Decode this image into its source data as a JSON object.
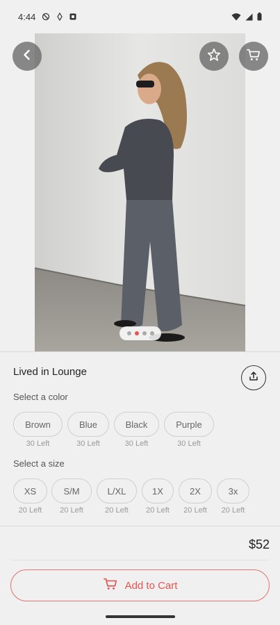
{
  "status_bar": {
    "time": "4:44",
    "icons": [
      "dnd-icon",
      "data-saver-icon",
      "notification-icon",
      "wifi-icon",
      "signal-icon",
      "battery-icon"
    ]
  },
  "header": {
    "back_icon": "chevron-left-icon",
    "favorite_icon": "star-outline-icon",
    "cart_icon": "cart-icon"
  },
  "gallery": {
    "image_count": 4,
    "active_index": 1,
    "image": "photo of woman in grey loungewear set"
  },
  "product": {
    "title": "Lived in Lounge",
    "share_icon": "share-icon",
    "price": "$52"
  },
  "colors": {
    "label": "Select a color",
    "options": [
      {
        "name": "Brown",
        "stock": "30 Left"
      },
      {
        "name": "Blue",
        "stock": "30 Left"
      },
      {
        "name": "Black",
        "stock": "30 Left"
      },
      {
        "name": "Purple",
        "stock": "30 Left"
      }
    ]
  },
  "sizes": {
    "label": "Select a size",
    "options": [
      {
        "name": "XS",
        "stock": "20 Left"
      },
      {
        "name": "S/M",
        "stock": "20 Left"
      },
      {
        "name": "L/XL",
        "stock": "20 Left"
      },
      {
        "name": "1X",
        "stock": "20 Left"
      },
      {
        "name": "2X",
        "stock": "20 Left"
      },
      {
        "name": "3x",
        "stock": "20 Left"
      }
    ]
  },
  "cta": {
    "label": "Add to Cart",
    "icon": "cart-icon",
    "accent": "#e8524f"
  }
}
